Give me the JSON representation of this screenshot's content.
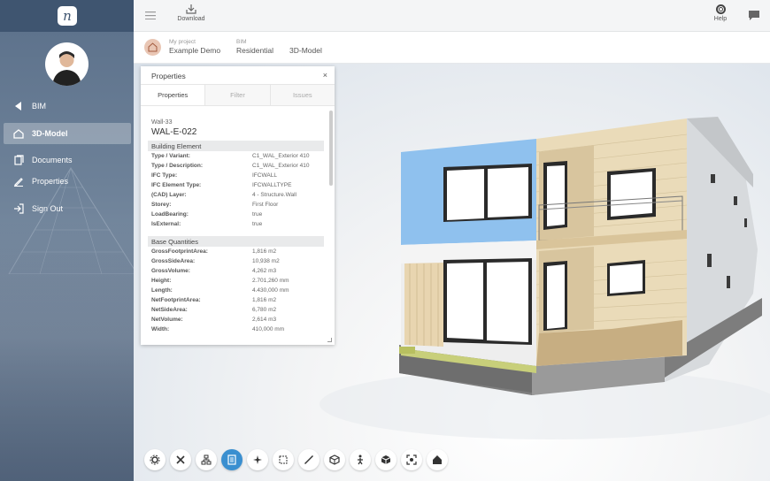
{
  "app": {
    "logo_letter": "n"
  },
  "sidebar": {
    "items": [
      {
        "label": "BIM",
        "icon": "caret-left-icon"
      },
      {
        "label": "3D-Model",
        "icon": "house-icon",
        "active": true
      },
      {
        "label": "Documents",
        "icon": "documents-icon"
      },
      {
        "label": "Properties",
        "icon": "pencil-icon"
      },
      {
        "label": "Sign Out",
        "icon": "sign-out-icon"
      }
    ]
  },
  "topbar": {
    "download_label": "Download",
    "help_label": "Help"
  },
  "breadcrumb": [
    {
      "caption": "My project",
      "value": "Example Demo"
    },
    {
      "caption": "BIM",
      "value": "Residential"
    },
    {
      "caption": "",
      "value": "3D-Model"
    }
  ],
  "panel": {
    "title": "Properties",
    "close": "×",
    "tabs": [
      "Properties",
      "Filter",
      "Issues"
    ],
    "element_type": "Wall-33",
    "element_name": "WAL-E-022",
    "sections": [
      {
        "title": "Building Element",
        "rows": [
          {
            "k": "Type / Variant:",
            "v": "C1_WAL_Exterior 410"
          },
          {
            "k": "Type / Description:",
            "v": "C1_WAL_Exterior 410"
          },
          {
            "k": "IFC Type:",
            "v": "IFCWALL"
          },
          {
            "k": "IFC Element Type:",
            "v": "IFCWALLTYPE"
          },
          {
            "k": "(CAD) Layer:",
            "v": "4 - Structure.Wall"
          },
          {
            "k": "Storey:",
            "v": "First Floor"
          },
          {
            "k": "LoadBearing:",
            "v": "true"
          },
          {
            "k": "IsExternal:",
            "v": "true"
          }
        ]
      },
      {
        "title": "Base Quantities",
        "rows": [
          {
            "k": "GrossFootprintArea:",
            "v": "1,816 m2"
          },
          {
            "k": "GrossSideArea:",
            "v": "10,938 m2"
          },
          {
            "k": "GrossVolume:",
            "v": "4,262 m3"
          },
          {
            "k": "Height:",
            "v": "2.701,260 mm"
          },
          {
            "k": "Length:",
            "v": "4.430,000 mm"
          },
          {
            "k": "NetFootprintArea:",
            "v": "1,816 m2"
          },
          {
            "k": "NetSideArea:",
            "v": "6,780 m2"
          },
          {
            "k": "NetVolume:",
            "v": "2,614 m3"
          },
          {
            "k": "Width:",
            "v": "410,000 mm"
          }
        ]
      }
    ]
  },
  "toolbar": {
    "buttons": [
      {
        "icon": "settings-icon"
      },
      {
        "icon": "tools-icon"
      },
      {
        "icon": "structure-icon"
      },
      {
        "icon": "properties-panel-icon",
        "active": true
      },
      {
        "icon": "focus-icon"
      },
      {
        "icon": "section-box-icon"
      },
      {
        "icon": "measure-icon"
      },
      {
        "icon": "explode-icon"
      },
      {
        "icon": "walk-icon"
      },
      {
        "icon": "cube-icon"
      },
      {
        "icon": "fit-view-icon"
      },
      {
        "icon": "home-icon"
      }
    ]
  },
  "colors": {
    "sidebar": "#5b708a",
    "accent": "#3a8fd0",
    "highlight_wall": "#8fc1ee"
  }
}
